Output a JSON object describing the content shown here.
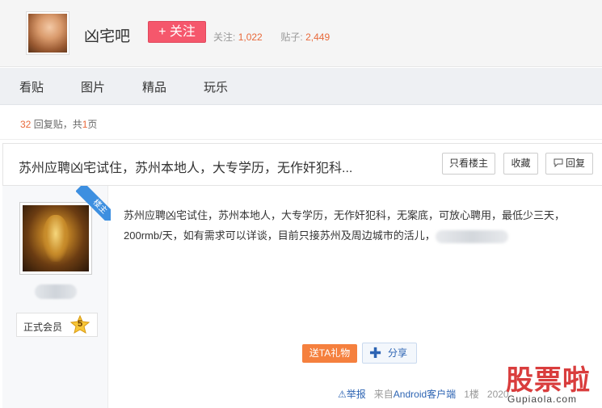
{
  "header": {
    "forum_name": "凶宅吧",
    "follow_label": "+ 关注",
    "follow_stat_label": "关注:",
    "follow_count": "1,022",
    "posts_stat_label": "贴子:",
    "posts_count": "2,449"
  },
  "nav": {
    "items": [
      "看贴",
      "图片",
      "精品",
      "玩乐"
    ]
  },
  "reply_info": {
    "count": "32",
    "text_mid": "回复贴，共",
    "pages": "1",
    "text_end": "页"
  },
  "post": {
    "title": "苏州应聘凶宅试住，苏州本地人，大专学历，无作奸犯科...",
    "only_op_label": "只看楼主",
    "favorite_label": "收藏",
    "reply_label": "回复",
    "op_badge": "楼主",
    "member_label": "正式会员",
    "level": "5",
    "content": "苏州应聘凶宅试住，苏州本地人，大专学历，无作奸犯科，无案底，可放心聘用，最低少三天，200rmb/天，如有需求可以详谈，目前只接苏州及周边城市的活儿，",
    "gift_label": "送TA礼物",
    "share_label": "分享",
    "report_label": "⚠举报",
    "source_prefix": "来自",
    "source_link": "Android客户端",
    "floor": "1楼",
    "date_partial": "2020"
  },
  "watermark": {
    "cn": "股票啦",
    "en": "Gupiaola.com"
  },
  "colors": {
    "accent_red": "#f5576c",
    "link_blue": "#2d64b3",
    "number_orange": "#e8693a",
    "gift_orange": "#f5803e",
    "op_badge_blue": "#3d8fe0"
  }
}
